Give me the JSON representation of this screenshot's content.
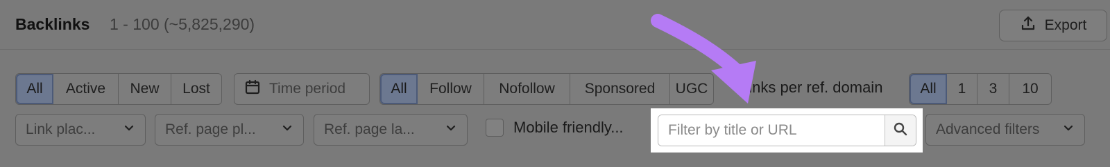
{
  "header": {
    "title": "Backlinks",
    "count": "1 - 100 (~5,825,290)",
    "export_label": "Export"
  },
  "status_filter": {
    "options": [
      "All",
      "Active",
      "New",
      "Lost"
    ],
    "selected": "All"
  },
  "time_period": {
    "label": "Time period",
    "icon": "calendar-icon"
  },
  "link_type_filter": {
    "options": [
      "All",
      "Follow",
      "Nofollow",
      "Sponsored",
      "UGC"
    ],
    "selected": "All"
  },
  "links_per_ref_domain": {
    "label": "Links per ref. domain",
    "options": [
      "All",
      "1",
      "3",
      "10"
    ],
    "selected": "All"
  },
  "dropdowns": {
    "link_placement": "Link plac...",
    "ref_page_platform": "Ref. page pl...",
    "ref_page_language": "Ref. page la..."
  },
  "mobile_friendly": {
    "label": "Mobile friendly...",
    "checked": false
  },
  "search": {
    "placeholder": "Filter by title or URL",
    "value": ""
  },
  "advanced_filters": {
    "label": "Advanced filters"
  },
  "colors": {
    "overlay": "#7a7a7a",
    "arrow": "#b57bf5",
    "highlight": "#ffffff",
    "active_segment": "#6c7890"
  }
}
